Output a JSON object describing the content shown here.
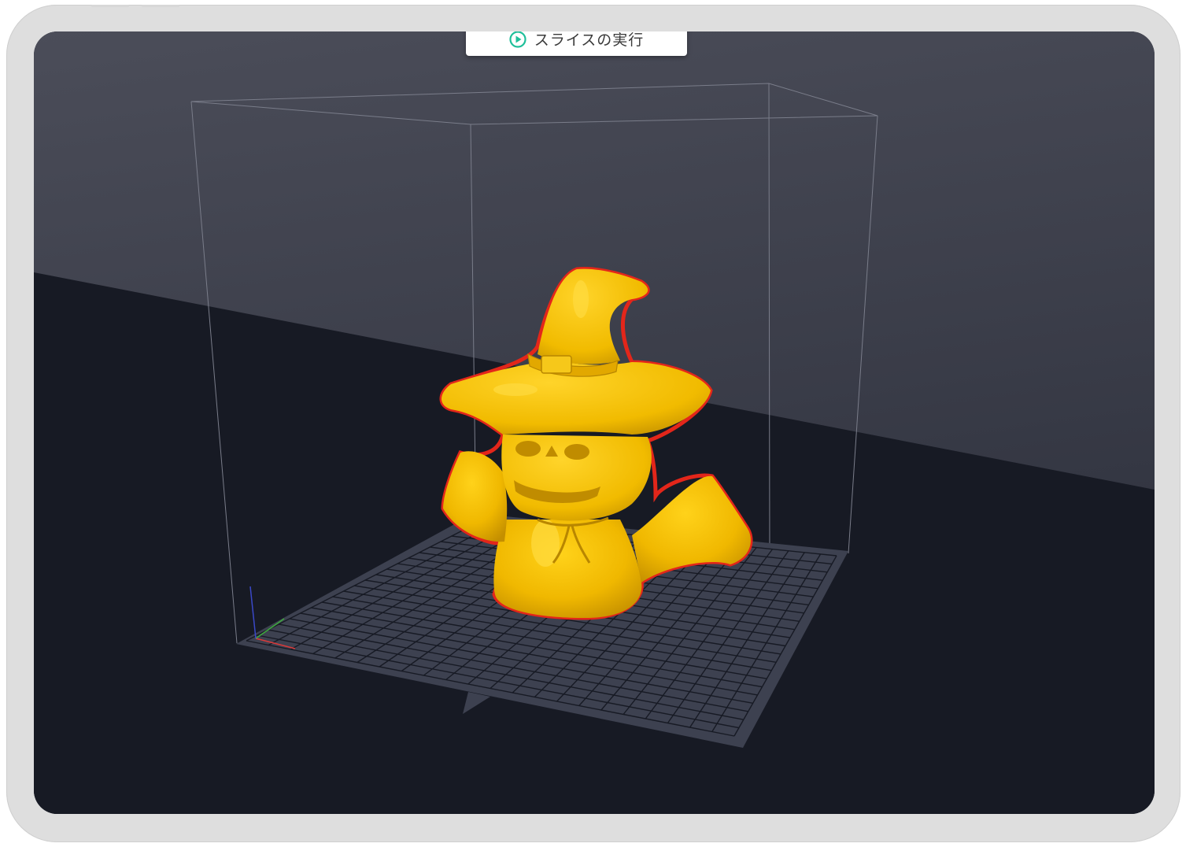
{
  "toolbar": {
    "slice_button": {
      "label": "スライスの実行",
      "icon": "play-circle-icon"
    }
  },
  "viewport": {
    "model": "witch-hat-pumpkin-ghost",
    "model_color": "#f2bd00",
    "selection_outline_color": "#e3261a",
    "build_plate_color": "#3d4150",
    "background_top": "#4a4c58",
    "background_floor": "#171a24"
  },
  "axis_gizmo": {
    "x_color": "#d93a3a",
    "y_color": "#3eaa3e",
    "z_color": "#3a48c8"
  }
}
